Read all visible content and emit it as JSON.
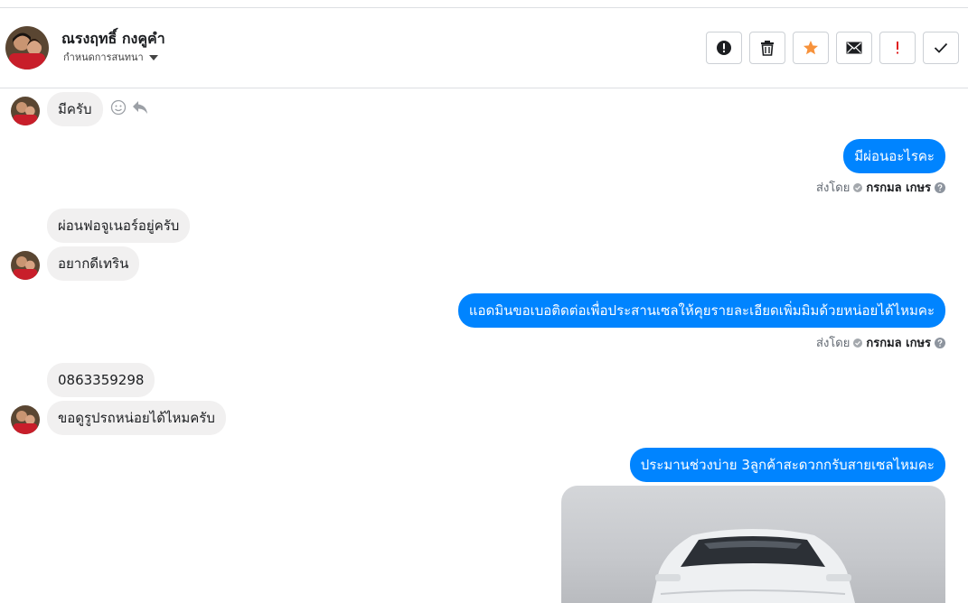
{
  "header": {
    "contact_name": "ณรงฤทธิ์ กงคูคำ",
    "assign_label": "กำหนดการสนทนา",
    "toolbar": {
      "buttons": [
        {
          "name": "spam-button",
          "icon": "exclamation-circle-icon"
        },
        {
          "name": "delete-button",
          "icon": "trash-icon"
        },
        {
          "name": "star-button",
          "icon": "star-icon",
          "color": "#f7923b"
        },
        {
          "name": "mark-unread-button",
          "icon": "envelope-icon"
        },
        {
          "name": "important-button",
          "icon": "exclamation-icon",
          "color": "#e02020"
        },
        {
          "name": "done-button",
          "icon": "check-icon"
        }
      ]
    }
  },
  "messages": {
    "m1": "มีครับ",
    "m2": "มีผ่อนอะไรคะ",
    "m3": "ผ่อนฟอจูเนอร์อยู่ครับ",
    "m4": "อยากดีเทริน",
    "m5": "แอดมินขอเบอติดต่อเพื่อประสานเซลให้คุยรายละเอียดเพิ่มมิมด้วยหน่อยได้ไหมคะ",
    "m6": "0863359298",
    "m7": "ขอดูรูปรถหน่อยได้ไหมครับ",
    "m8": "ประมานช่วงบ่าย 3ลูกค้าสะดวกกรับสายเซลไหมคะ"
  },
  "sent_meta": {
    "prefix": "ส่งโดย",
    "agent": "กรกมล เกษร"
  },
  "colors": {
    "outgoing_bubble": "#0084ff",
    "incoming_bubble": "#f1f0f0"
  }
}
